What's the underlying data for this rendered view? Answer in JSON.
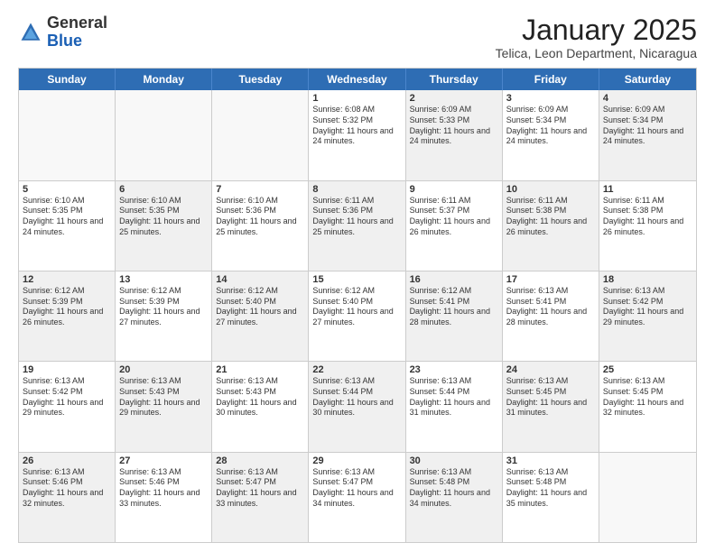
{
  "header": {
    "logo_general": "General",
    "logo_blue": "Blue",
    "month_title": "January 2025",
    "location": "Telica, Leon Department, Nicaragua"
  },
  "weekdays": [
    "Sunday",
    "Monday",
    "Tuesday",
    "Wednesday",
    "Thursday",
    "Friday",
    "Saturday"
  ],
  "rows": [
    [
      {
        "day": "",
        "text": "",
        "shaded": false,
        "empty": true
      },
      {
        "day": "",
        "text": "",
        "shaded": false,
        "empty": true
      },
      {
        "day": "",
        "text": "",
        "shaded": false,
        "empty": true
      },
      {
        "day": "1",
        "text": "Sunrise: 6:08 AM\nSunset: 5:32 PM\nDaylight: 11 hours and 24 minutes.",
        "shaded": false
      },
      {
        "day": "2",
        "text": "Sunrise: 6:09 AM\nSunset: 5:33 PM\nDaylight: 11 hours and 24 minutes.",
        "shaded": true
      },
      {
        "day": "3",
        "text": "Sunrise: 6:09 AM\nSunset: 5:34 PM\nDaylight: 11 hours and 24 minutes.",
        "shaded": false
      },
      {
        "day": "4",
        "text": "Sunrise: 6:09 AM\nSunset: 5:34 PM\nDaylight: 11 hours and 24 minutes.",
        "shaded": true
      }
    ],
    [
      {
        "day": "5",
        "text": "Sunrise: 6:10 AM\nSunset: 5:35 PM\nDaylight: 11 hours and 24 minutes.",
        "shaded": false
      },
      {
        "day": "6",
        "text": "Sunrise: 6:10 AM\nSunset: 5:35 PM\nDaylight: 11 hours and 25 minutes.",
        "shaded": true
      },
      {
        "day": "7",
        "text": "Sunrise: 6:10 AM\nSunset: 5:36 PM\nDaylight: 11 hours and 25 minutes.",
        "shaded": false
      },
      {
        "day": "8",
        "text": "Sunrise: 6:11 AM\nSunset: 5:36 PM\nDaylight: 11 hours and 25 minutes.",
        "shaded": true
      },
      {
        "day": "9",
        "text": "Sunrise: 6:11 AM\nSunset: 5:37 PM\nDaylight: 11 hours and 26 minutes.",
        "shaded": false
      },
      {
        "day": "10",
        "text": "Sunrise: 6:11 AM\nSunset: 5:38 PM\nDaylight: 11 hours and 26 minutes.",
        "shaded": true
      },
      {
        "day": "11",
        "text": "Sunrise: 6:11 AM\nSunset: 5:38 PM\nDaylight: 11 hours and 26 minutes.",
        "shaded": false
      }
    ],
    [
      {
        "day": "12",
        "text": "Sunrise: 6:12 AM\nSunset: 5:39 PM\nDaylight: 11 hours and 26 minutes.",
        "shaded": true
      },
      {
        "day": "13",
        "text": "Sunrise: 6:12 AM\nSunset: 5:39 PM\nDaylight: 11 hours and 27 minutes.",
        "shaded": false
      },
      {
        "day": "14",
        "text": "Sunrise: 6:12 AM\nSunset: 5:40 PM\nDaylight: 11 hours and 27 minutes.",
        "shaded": true
      },
      {
        "day": "15",
        "text": "Sunrise: 6:12 AM\nSunset: 5:40 PM\nDaylight: 11 hours and 27 minutes.",
        "shaded": false
      },
      {
        "day": "16",
        "text": "Sunrise: 6:12 AM\nSunset: 5:41 PM\nDaylight: 11 hours and 28 minutes.",
        "shaded": true
      },
      {
        "day": "17",
        "text": "Sunrise: 6:13 AM\nSunset: 5:41 PM\nDaylight: 11 hours and 28 minutes.",
        "shaded": false
      },
      {
        "day": "18",
        "text": "Sunrise: 6:13 AM\nSunset: 5:42 PM\nDaylight: 11 hours and 29 minutes.",
        "shaded": true
      }
    ],
    [
      {
        "day": "19",
        "text": "Sunrise: 6:13 AM\nSunset: 5:42 PM\nDaylight: 11 hours and 29 minutes.",
        "shaded": false
      },
      {
        "day": "20",
        "text": "Sunrise: 6:13 AM\nSunset: 5:43 PM\nDaylight: 11 hours and 29 minutes.",
        "shaded": true
      },
      {
        "day": "21",
        "text": "Sunrise: 6:13 AM\nSunset: 5:43 PM\nDaylight: 11 hours and 30 minutes.",
        "shaded": false
      },
      {
        "day": "22",
        "text": "Sunrise: 6:13 AM\nSunset: 5:44 PM\nDaylight: 11 hours and 30 minutes.",
        "shaded": true
      },
      {
        "day": "23",
        "text": "Sunrise: 6:13 AM\nSunset: 5:44 PM\nDaylight: 11 hours and 31 minutes.",
        "shaded": false
      },
      {
        "day": "24",
        "text": "Sunrise: 6:13 AM\nSunset: 5:45 PM\nDaylight: 11 hours and 31 minutes.",
        "shaded": true
      },
      {
        "day": "25",
        "text": "Sunrise: 6:13 AM\nSunset: 5:45 PM\nDaylight: 11 hours and 32 minutes.",
        "shaded": false
      }
    ],
    [
      {
        "day": "26",
        "text": "Sunrise: 6:13 AM\nSunset: 5:46 PM\nDaylight: 11 hours and 32 minutes.",
        "shaded": true
      },
      {
        "day": "27",
        "text": "Sunrise: 6:13 AM\nSunset: 5:46 PM\nDaylight: 11 hours and 33 minutes.",
        "shaded": false
      },
      {
        "day": "28",
        "text": "Sunrise: 6:13 AM\nSunset: 5:47 PM\nDaylight: 11 hours and 33 minutes.",
        "shaded": true
      },
      {
        "day": "29",
        "text": "Sunrise: 6:13 AM\nSunset: 5:47 PM\nDaylight: 11 hours and 34 minutes.",
        "shaded": false
      },
      {
        "day": "30",
        "text": "Sunrise: 6:13 AM\nSunset: 5:48 PM\nDaylight: 11 hours and 34 minutes.",
        "shaded": true
      },
      {
        "day": "31",
        "text": "Sunrise: 6:13 AM\nSunset: 5:48 PM\nDaylight: 11 hours and 35 minutes.",
        "shaded": false
      },
      {
        "day": "",
        "text": "",
        "shaded": false,
        "empty": true
      }
    ]
  ]
}
